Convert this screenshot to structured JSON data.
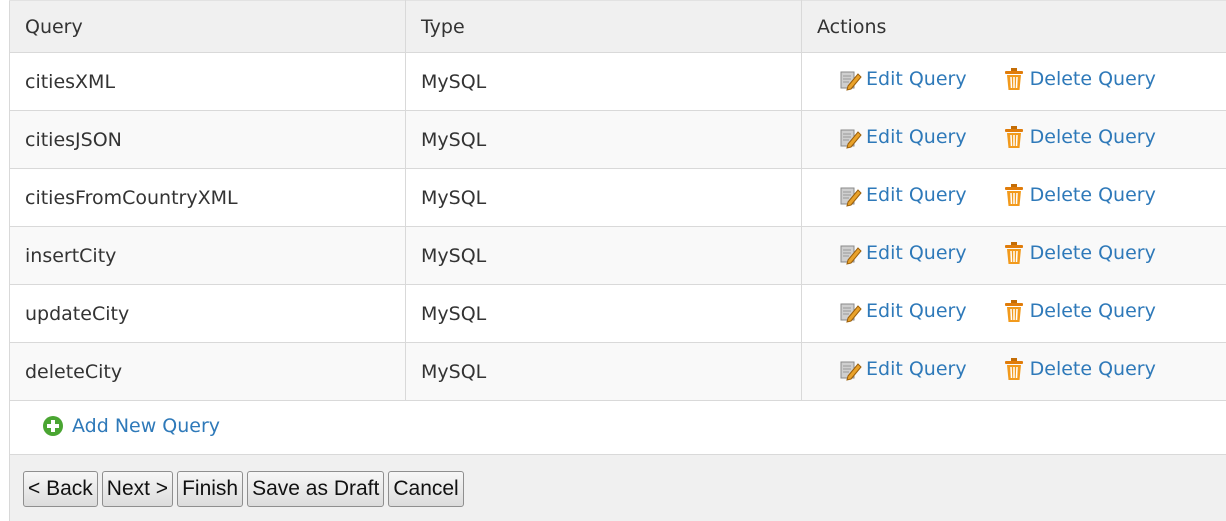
{
  "table": {
    "headers": {
      "query": "Query",
      "type": "Type",
      "actions": "Actions"
    },
    "rows": [
      {
        "query": "citiesXML",
        "type": "MySQL"
      },
      {
        "query": "citiesJSON",
        "type": "MySQL"
      },
      {
        "query": "citiesFromCountryXML",
        "type": "MySQL"
      },
      {
        "query": "insertCity",
        "type": "MySQL"
      },
      {
        "query": "updateCity",
        "type": "MySQL"
      },
      {
        "query": "deleteCity",
        "type": "MySQL"
      }
    ],
    "edit_label": "Edit Query",
    "delete_label": "Delete Query",
    "add_label": "Add New Query"
  },
  "buttons": {
    "back": "< Back",
    "next": "Next >",
    "finish": "Finish",
    "save_draft": "Save as Draft",
    "cancel": "Cancel"
  },
  "icons": {
    "edit": "edit-pencil-icon",
    "delete": "trash-icon",
    "add": "add-circle-icon"
  },
  "colors": {
    "link": "#2e79b9",
    "header_bg": "#f0f0f0",
    "border": "#d9d9d9"
  }
}
